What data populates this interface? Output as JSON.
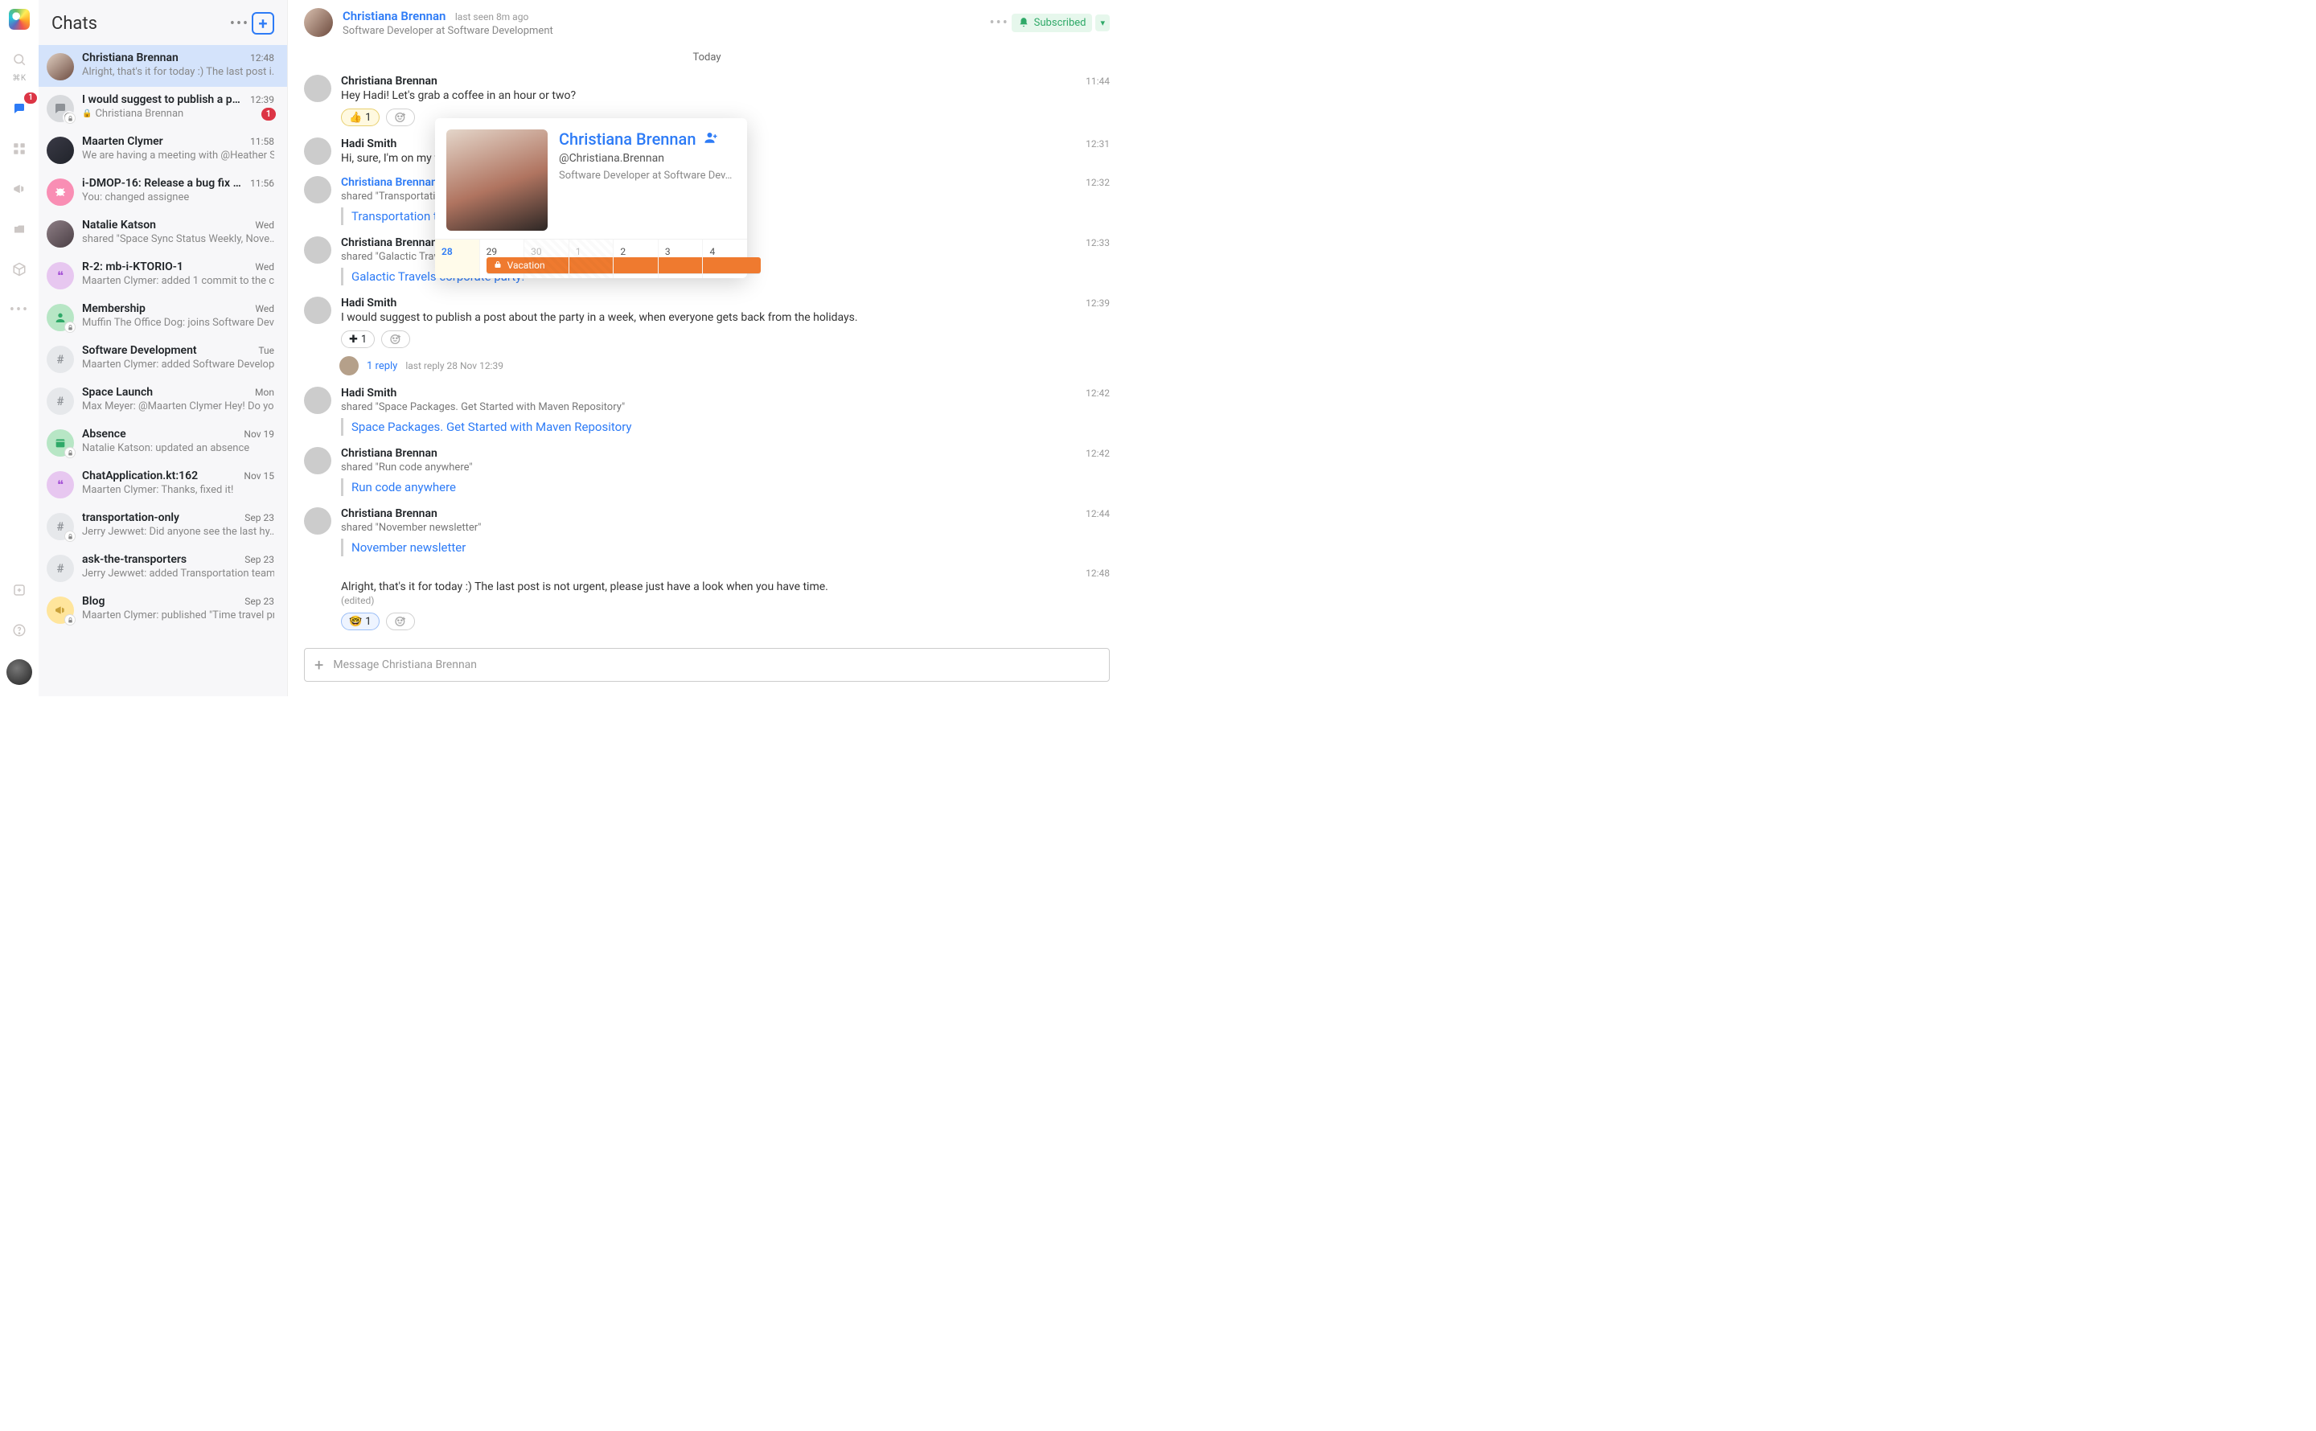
{
  "app": {
    "title": "Chats",
    "shortcut": "⌘K"
  },
  "rail": {
    "chat_badge": "1",
    "icons": [
      "app-logo",
      "search",
      "chats",
      "apps",
      "announcements",
      "projects",
      "packages",
      "more",
      "add",
      "help",
      "me"
    ]
  },
  "chatlist": {
    "items": [
      {
        "name": "Christiana Brennan",
        "preview": "Alright, that's it for today :) The last post i…",
        "time": "12:48",
        "avatar": "grad-cb",
        "selected": true
      },
      {
        "name": "I would suggest to publish a p…",
        "preview": "Christiana Brennan",
        "time": "12:39",
        "avatar": "grad-bubble",
        "badge": "1",
        "lock": true,
        "bubble": true,
        "corner_av": true
      },
      {
        "name": "Maarten Clymer",
        "preview": "We are having a meeting with @Heather S…",
        "time": "11:58",
        "avatar": "grad-mc"
      },
      {
        "name": "i-DMOP-16: Release a bug fix …",
        "preview": "You: changed assignee",
        "time": "11:56",
        "avatar": "grad-bug"
      },
      {
        "name": "Natalie Katson",
        "preview": "shared \"Space Sync Status Weekly, Nove…",
        "time": "Wed",
        "avatar": "grad-nk"
      },
      {
        "name": "R-2: mb-i-KTORIO-1",
        "preview": "Maarten Clymer: added 1 commit to the c…",
        "time": "Wed",
        "avatar": "grad-quote"
      },
      {
        "name": "Membership",
        "preview": "Muffin The Office Dog: joins Software Dev…",
        "time": "Wed",
        "avatar": "grad-member",
        "lock": true
      },
      {
        "name": "Software Development",
        "preview": "Maarten Clymer: added Software Develop…",
        "time": "Tue",
        "avatar": "grad-hash"
      },
      {
        "name": "Space Launch",
        "preview": "Max Meyer: @Maarten Clymer Hey! Do yo…",
        "time": "Mon",
        "avatar": "grad-hash"
      },
      {
        "name": "Absence",
        "preview": "Natalie Katson: updated an absence",
        "time": "Nov 19",
        "avatar": "grad-cal",
        "lock": true
      },
      {
        "name": "ChatApplication.kt:162",
        "preview": "Maarten Clymer: Thanks, fixed it!",
        "time": "Nov 15",
        "avatar": "grad-quote"
      },
      {
        "name": "transportation-only",
        "preview": "Jerry Jewwet: Did anyone see the last hy…",
        "time": "Sep 23",
        "avatar": "grad-hash",
        "lock": true
      },
      {
        "name": "ask-the-transporters",
        "preview": "Jerry Jewwet: added Transportation team…",
        "time": "Sep 23",
        "avatar": "grad-hash"
      },
      {
        "name": "Blog",
        "preview": "Maarten Clymer: published \"Time travel pr…",
        "time": "Sep 23",
        "avatar": "grad-blog",
        "lock": true
      }
    ]
  },
  "header": {
    "name": "Christiana Brennan",
    "seen": "last seen 8m ago",
    "role": "Software Developer at Software Development",
    "subscribed": "Subscribed"
  },
  "day_separator": "Today",
  "messages": [
    {
      "author": "Christiana Brennan",
      "time": "11:44",
      "avatar": "grad-cb",
      "text": "Hey Hadi! Let's grab a coffee in an hour or two?",
      "reactions": [
        {
          "emoji": "👍",
          "count": "1",
          "on": true
        }
      ],
      "add": true
    },
    {
      "author": "Hadi Smith",
      "time": "12:31",
      "avatar": "grad-hs",
      "text": "Hi, sure, I'm on my w"
    },
    {
      "author": "Christiana Brennan",
      "time": "12:32",
      "avatar": "grad-cb",
      "author_link": true,
      "sub": "shared \"Transportation",
      "link": "Transportation t"
    },
    {
      "author": "Christiana Brennan",
      "time": "12:33",
      "avatar": "grad-cb",
      "sub": "shared \"Galactic Travel",
      "link": "Galactic Travels corporate party!"
    },
    {
      "author": "Hadi Smith",
      "time": "12:39",
      "avatar": "grad-hs",
      "text": "I would suggest to publish a post about the party in a week, when everyone gets back from the holidays.",
      "reactions": [
        {
          "emoji": "✚",
          "count": "1",
          "on": false
        }
      ],
      "add": true,
      "thread": {
        "replies": "1 reply",
        "meta": "last reply 28 Nov 12:39"
      }
    },
    {
      "author": "Hadi Smith",
      "time": "12:42",
      "avatar": "grad-hs",
      "sub": "shared \"Space Packages. Get Started with Maven Repository\"",
      "link": "Space Packages. Get Started with Maven Repository"
    },
    {
      "author": "Christiana Brennan",
      "time": "12:42",
      "avatar": "grad-cb",
      "sub": "shared \"Run code anywhere\"",
      "link": "Run code anywhere"
    },
    {
      "author": "Christiana Brennan",
      "time": "12:44",
      "avatar": "grad-cb",
      "sub": "shared \"November newsletter\"",
      "link": "November newsletter"
    },
    {
      "author_skip": true,
      "time": "12:48",
      "text": "Alright, that's it for today :) The last post is not urgent, please just have a look when you have time.",
      "edited": "(edited)",
      "reactions": [
        {
          "emoji": "🤓",
          "count": "1",
          "on": false,
          "blue": true
        }
      ],
      "add": true
    }
  ],
  "profile_card": {
    "name": "Christiana Brennan",
    "handle": "@Christiana.Brennan",
    "desc": "Software Developer at Software Dev…",
    "days": [
      {
        "n": "28",
        "today": true
      },
      {
        "n": "29"
      },
      {
        "n": "30",
        "weekend": true
      },
      {
        "n": "1",
        "weekend": true
      },
      {
        "n": "2"
      },
      {
        "n": "3"
      },
      {
        "n": "4"
      }
    ],
    "vacation": "Vacation"
  },
  "composer": {
    "placeholder": "Message Christiana Brennan"
  }
}
